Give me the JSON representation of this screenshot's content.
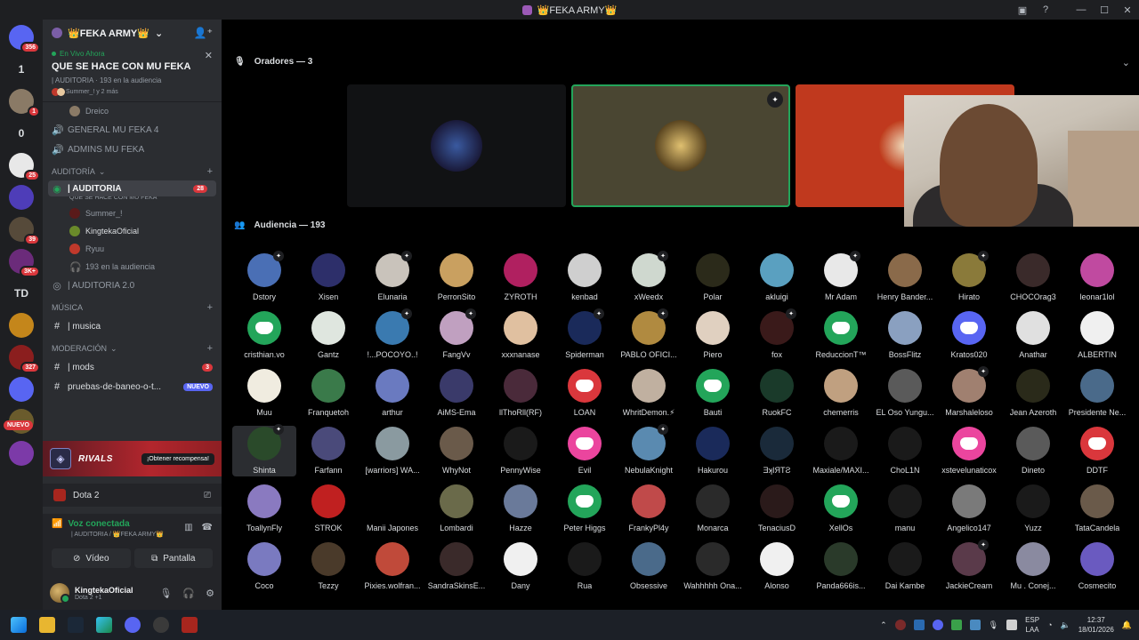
{
  "window": {
    "title": "👑FEKA ARMY👑"
  },
  "rail": {
    "servers": [
      {
        "label": "",
        "badge": "356",
        "color": "#5865f2"
      },
      {
        "label": "1",
        "badge": "",
        "color": ""
      },
      {
        "label": "",
        "badge": "1",
        "color": "#8a7a66"
      },
      {
        "label": "0",
        "badge": "",
        "color": ""
      },
      {
        "label": "",
        "badge": "25",
        "color": "#e8e8e8"
      },
      {
        "label": "",
        "badge": "",
        "color": "#4e3db8"
      },
      {
        "label": "",
        "badge": "39",
        "color": "#564a3a"
      },
      {
        "label": "",
        "badge": "3K+",
        "color": "#6b2b7a"
      },
      {
        "label": "TD",
        "badge": "",
        "color": ""
      },
      {
        "label": "",
        "badge": "",
        "color": "#c4861b"
      },
      {
        "label": "",
        "badge": "327",
        "color": "#8b1e1e"
      },
      {
        "label": "",
        "badge": "",
        "color": "#5865f2"
      },
      {
        "label": "",
        "badge": "",
        "color": "#6a5b2c"
      },
      {
        "label": "",
        "badge": "",
        "color": "#7c3aa8"
      }
    ],
    "nuevo": "NUEVO"
  },
  "sidebar": {
    "server_name": "👑FEKA ARMY👑",
    "live": {
      "label": "En Vivo Ahora",
      "title": "QUE SE HACE CON MU FEKA",
      "meta": "| AUDITORIA · 193 en la audiencia",
      "people": "Summer_! y 2 más"
    },
    "channels_top": [
      {
        "name": "Dreico",
        "icon": "👤",
        "sub": true
      },
      {
        "name": "GENERAL MU FEKA 4",
        "icon": "🔊",
        "sub": false
      },
      {
        "name": "ADMINS MU FEKA",
        "icon": "🔊",
        "sub": false
      }
    ],
    "cat_auditoria": "AUDITORÍA",
    "stage_channel": {
      "name": "| AUDITORIA",
      "count": "28",
      "subtitle": "QUE SE HACE CON MU FEKA"
    },
    "stage_members": [
      "Summer_!",
      "KingtekaOficial",
      "Ryuu",
      "193 en la audiencia"
    ],
    "auditoria2": "| AUDITORIA 2.0",
    "cat_musica": "MÚSICA",
    "musica": "| musica",
    "cat_moderacion": "MODERACIÓN",
    "mods": {
      "name": "| mods",
      "count": "3"
    },
    "baneo": {
      "name": "pruebas-de-baneo-o-t...",
      "badge": "NUEVO"
    }
  },
  "rivals": {
    "label": "RIVALS",
    "button": "¡Obtener recompensa!"
  },
  "game": {
    "name": "Dota 2"
  },
  "voice": {
    "status": "Voz conectada",
    "sub": "| AUDITORIA / 👑FEKA ARMY👑",
    "video": "Vídeo",
    "screen": "Pantalla"
  },
  "user": {
    "name": "KingtekaOficial",
    "status": "Dota 2 +1"
  },
  "stage": {
    "speakers_header": "Oradores — 3",
    "audience_header": "Audiencia — 193"
  },
  "audience": [
    {
      "n": "Dstory",
      "c": "#4a6fb5",
      "h": true
    },
    {
      "n": "Xisen",
      "c": "#2d2f6a",
      "h": false
    },
    {
      "n": "Elunaria",
      "c": "#c9c3bb",
      "h": true
    },
    {
      "n": "PerronSito",
      "c": "#c9a060",
      "h": false
    },
    {
      "n": "ZYROTH",
      "c": "#b02060",
      "h": false
    },
    {
      "n": "kenbad",
      "c": "#cfcfcf",
      "h": false
    },
    {
      "n": "xWeedx",
      "c": "#cfd8cf",
      "h": true
    },
    {
      "n": "Polar",
      "c": "#2b2a1a",
      "h": false
    },
    {
      "n": "akluigi",
      "c": "#5aa0c0",
      "h": false
    },
    {
      "n": "Mr Adam",
      "c": "#e8e8e8",
      "h": true
    },
    {
      "n": "Henry Bander...",
      "c": "#8a6a4a",
      "h": false
    },
    {
      "n": "Hirato",
      "c": "#8a7a3a",
      "h": true
    },
    {
      "n": "CHOCOrag3",
      "c": "#3a2a2a",
      "h": false
    },
    {
      "n": "leonar1lol",
      "c": "#c04aa0",
      "h": false
    },
    {
      "n": "cristhian.vo",
      "c": "#23a55a",
      "h": false,
      "d": true
    },
    {
      "n": "Gantz",
      "c": "#dfe6df",
      "h": false
    },
    {
      "n": "!...POCOYO..!",
      "c": "#3a7ab0",
      "h": true
    },
    {
      "n": "FangVv",
      "c": "#c0a0c0",
      "h": true
    },
    {
      "n": "xxxnanase",
      "c": "#e0c0a0",
      "h": false
    },
    {
      "n": "Spiderman",
      "c": "#1a2a5a",
      "h": true
    },
    {
      "n": "PABLO OFICI...",
      "c": "#b08a40",
      "h": true
    },
    {
      "n": "Piero",
      "c": "#e0d0c0",
      "h": false
    },
    {
      "n": "fox",
      "c": "#3a1a1a",
      "h": true
    },
    {
      "n": "ReduccionT™",
      "c": "#23a55a",
      "h": false,
      "d": true
    },
    {
      "n": "BossFlitz",
      "c": "#8aa0c0",
      "h": false
    },
    {
      "n": "Kratos020",
      "c": "#5865f2",
      "h": false,
      "d": true
    },
    {
      "n": "Anathar",
      "c": "#e0e0e0",
      "h": false
    },
    {
      "n": "ALBERTIN",
      "c": "#f0f0f0",
      "h": false
    },
    {
      "n": "Muu",
      "c": "#f0ece0",
      "h": false
    },
    {
      "n": "Franquetoh",
      "c": "#3a7a4a",
      "h": false
    },
    {
      "n": "arthur",
      "c": "#6a7ac0",
      "h": false
    },
    {
      "n": "AiMS-Ema",
      "c": "#3a3a6a",
      "h": false
    },
    {
      "n": "llThoRll(RF)",
      "c": "#4a2a3a",
      "h": false
    },
    {
      "n": "LOAN",
      "c": "#da373c",
      "h": false,
      "d": true
    },
    {
      "n": "WhritDemon.⚡",
      "c": "#c0b0a0",
      "h": false
    },
    {
      "n": "Bauti",
      "c": "#23a55a",
      "h": false,
      "d": true
    },
    {
      "n": "RuokFC",
      "c": "#1a3a2a",
      "h": false
    },
    {
      "n": "chemerris",
      "c": "#c0a080",
      "h": false
    },
    {
      "n": "EL Oso Yungu...",
      "c": "#5a5a5a",
      "h": false
    },
    {
      "n": "Marshaleloso",
      "c": "#a08070",
      "h": true
    },
    {
      "n": "Jean Azeroth",
      "c": "#2a2a1a",
      "h": false
    },
    {
      "n": "Presidente Ne...",
      "c": "#4a6a8a",
      "h": false
    },
    {
      "n": "Shinta",
      "c": "#2a4a2a",
      "h": true,
      "hl": true
    },
    {
      "n": "Farfann",
      "c": "#4a4a7a",
      "h": false
    },
    {
      "n": "[warriors] WA...",
      "c": "#8a9aa0",
      "h": false
    },
    {
      "n": "WhyNot",
      "c": "#6a5a4a",
      "h": false
    },
    {
      "n": "PennyWise",
      "c": "#1a1a1a",
      "h": false
    },
    {
      "n": "Evil",
      "c": "#eb459e",
      "h": false,
      "d": true
    },
    {
      "n": "NebulaKnight",
      "c": "#5a8ab0",
      "h": true
    },
    {
      "n": "Hakurou",
      "c": "#1a2a5a",
      "h": false
    },
    {
      "n": "ƎʞIЯTƧ",
      "c": "#1a2a3a",
      "h": false
    },
    {
      "n": "Maxiale/MAXI...",
      "c": "#1a1a1a",
      "h": false
    },
    {
      "n": "ChoL1N",
      "c": "#1a1a1a",
      "h": false
    },
    {
      "n": "xstevelunaticox",
      "c": "#eb459e",
      "h": false,
      "d": true
    },
    {
      "n": "Dineto",
      "c": "#5a5a5a",
      "h": false
    },
    {
      "n": "DDTF",
      "c": "#da373c",
      "h": false,
      "d": true
    },
    {
      "n": "ToallynFly",
      "c": "#8a7ac0",
      "h": false
    },
    {
      "n": "STROK",
      "c": "#c02020",
      "h": false
    },
    {
      "n": "Manii Japones",
      "c": "#000000",
      "h": false
    },
    {
      "n": "Lombardi",
      "c": "#6a6a4a",
      "h": false
    },
    {
      "n": "Hazze",
      "c": "#6a7a9a",
      "h": false
    },
    {
      "n": "Peter Higgs",
      "c": "#23a55a",
      "h": false,
      "d": true
    },
    {
      "n": "FrankyPl4y",
      "c": "#c04a4a",
      "h": false
    },
    {
      "n": "Monarca",
      "c": "#2a2a2a",
      "h": false
    },
    {
      "n": "TenaciusD",
      "c": "#2a1a1a",
      "h": false
    },
    {
      "n": "XellOs",
      "c": "#23a55a",
      "h": false,
      "d": true
    },
    {
      "n": "manu",
      "c": "#1a1a1a",
      "h": false
    },
    {
      "n": "Angelico147",
      "c": "#7a7a7a",
      "h": false
    },
    {
      "n": "Yuzz",
      "c": "#1a1a1a",
      "h": false
    },
    {
      "n": "TataCandela",
      "c": "#6a5a4a",
      "h": false
    },
    {
      "n": "Coco",
      "c": "#7a7ac0",
      "h": false
    },
    {
      "n": "Tezzy",
      "c": "#4a3a2a",
      "h": false
    },
    {
      "n": "Pixies.wolfran...",
      "c": "#c04a3a",
      "h": false
    },
    {
      "n": "SandraSkinsE...",
      "c": "#3a2a2a",
      "h": false
    },
    {
      "n": "Dany",
      "c": "#f0f0f0",
      "h": false
    },
    {
      "n": "Rua",
      "c": "#1a1a1a",
      "h": false
    },
    {
      "n": "Obsessive",
      "c": "#4a6a8a",
      "h": false
    },
    {
      "n": "Wahhhhh Ona...",
      "c": "#2a2a2a",
      "h": false
    },
    {
      "n": "Alonso",
      "c": "#f0f0f0",
      "h": false
    },
    {
      "n": "Panda666is...",
      "c": "#2a3a2a",
      "h": false
    },
    {
      "n": "Dai Kambe",
      "c": "#1a1a1a",
      "h": false
    },
    {
      "n": "JackieCream",
      "c": "#5a3a4a",
      "h": true
    },
    {
      "n": "Mu . Conej...",
      "c": "#8a8aa0",
      "h": false
    },
    {
      "n": "Cosmecito",
      "c": "#6a5ac0",
      "h": false
    }
  ],
  "taskbar": {
    "lang1": "ESP",
    "lang2": "LAA",
    "time": "12:37",
    "date": "18/01/2026"
  }
}
